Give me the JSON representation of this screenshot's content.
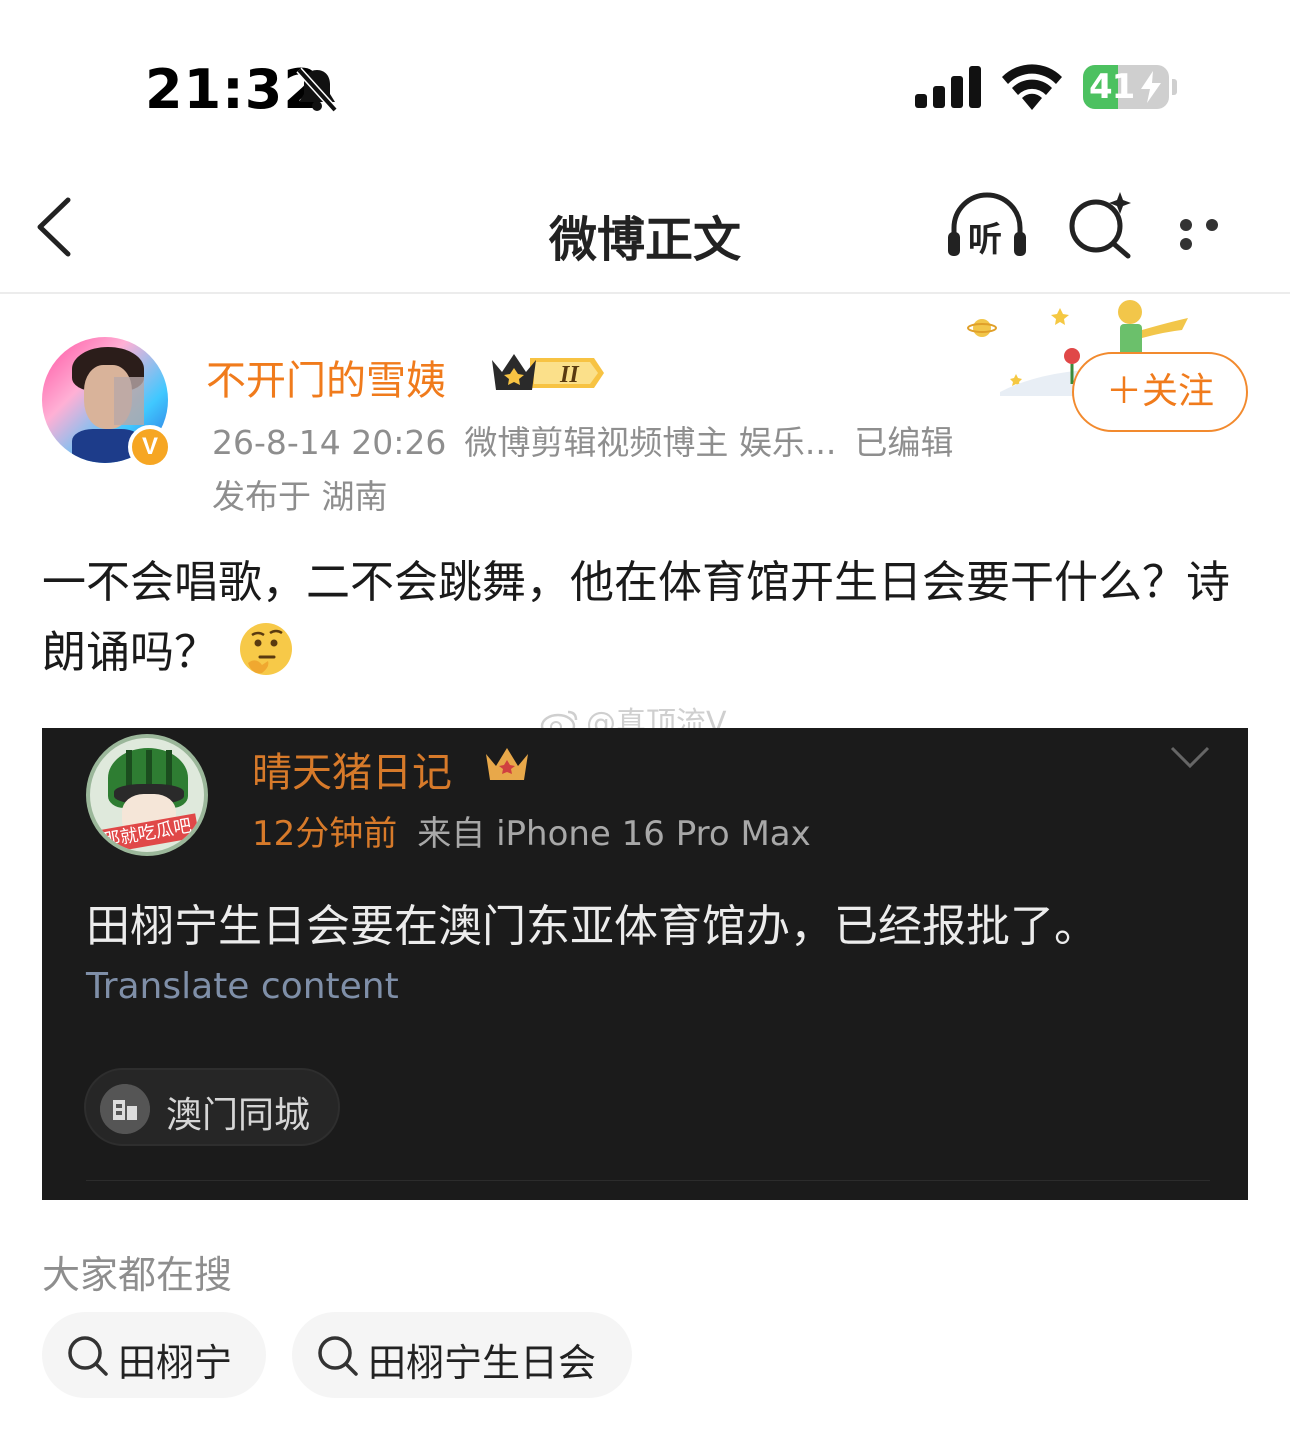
{
  "status_bar": {
    "time": "21:32",
    "battery_percent": 41,
    "battery_label": "41",
    "icons": [
      "bell-slash-icon",
      "cellular-signal-icon",
      "wifi-icon",
      "battery-charging-icon"
    ]
  },
  "nav": {
    "title": "微博正文",
    "listen_label": "听",
    "icons": [
      "chevron-left-icon",
      "headphones-listen-icon",
      "search-sparkle-icon",
      "more-dots-icon"
    ]
  },
  "post": {
    "author": "不开门的雪姨",
    "level_badge": "II",
    "timestamp": "26-8-14 20:26",
    "author_tag": "微博剪辑视频博主 娱乐...",
    "edited": "已编辑",
    "location": "发布于 湖南",
    "follow_label": "＋关注",
    "text": "一不会唱歌，二不会跳舞，他在体育馆开生日会要干什么？诗朗诵吗？",
    "emoji": "thinking-face-icon",
    "verified_mark": "V"
  },
  "watermark": "@真顶流V",
  "screenshot": {
    "name": "晴天猪日记",
    "avatar_tag": "那就吃瓜吧",
    "time_ago": "12分钟前",
    "source": "来自 iPhone 16 Pro Max",
    "text": "田栩宁生日会要在澳门东亚体育馆办，已经报批了。",
    "translate": "Translate content",
    "location_chip": "澳门同城"
  },
  "trending": {
    "title": "大家都在搜",
    "items": [
      "田栩宁",
      "田栩宁生日会"
    ]
  },
  "colors": {
    "accent_orange": "#f07b1c",
    "battery_green": "#4cc160",
    "dark_card": "#1b1b1b"
  }
}
